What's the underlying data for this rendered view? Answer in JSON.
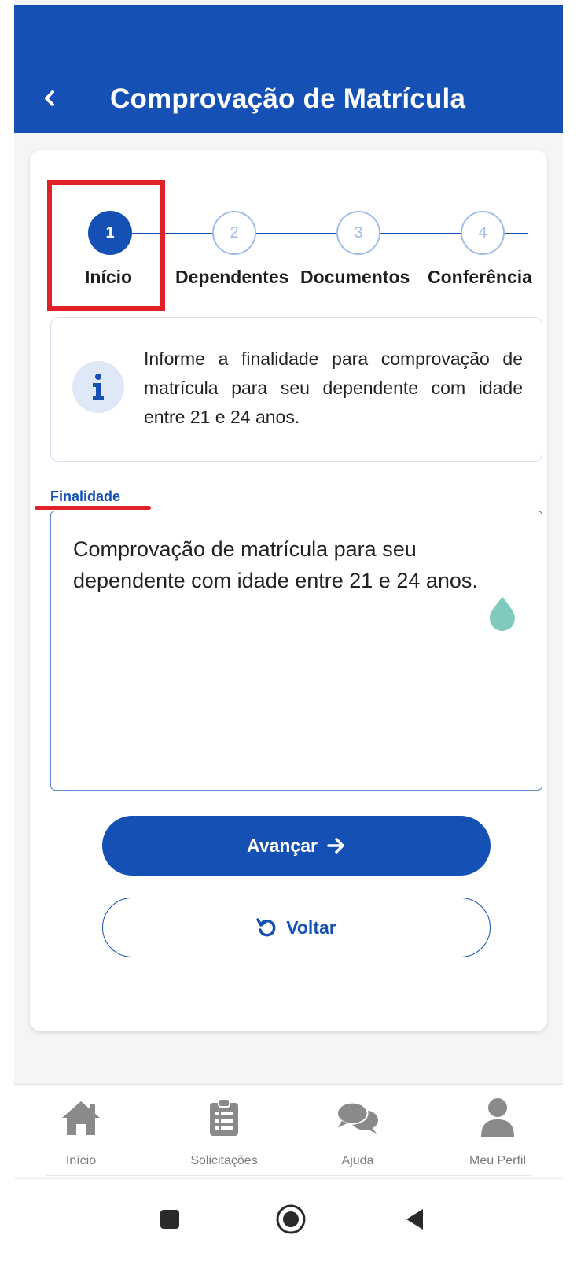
{
  "header": {
    "title": "Comprovação de Matrícula",
    "back_icon": "chevron-left-icon",
    "background_color": "#1550b4"
  },
  "stepper": {
    "steps": [
      {
        "number": "1",
        "label": "Início",
        "state": "active"
      },
      {
        "number": "2",
        "label": "Dependentes",
        "state": "inactive"
      },
      {
        "number": "3",
        "label": "Documentos",
        "state": "inactive"
      },
      {
        "number": "4",
        "label": "Conferência",
        "state": "inactive"
      }
    ],
    "active_color": "#1550b4",
    "inactive_color": "#9fbde8",
    "highlight_color": "#e02128"
  },
  "info": {
    "icon": "info-icon",
    "text": "Informe a finalidade para comprovação de matrícula para seu dependente com idade entre 21 e 24 anos."
  },
  "field": {
    "label": "Finalidade",
    "value": "Comprovação de matrícula para seu dependente com idade entre 21 e 24 anos."
  },
  "actions": {
    "primary_label": "Avançar",
    "primary_icon": "arrow-right-icon",
    "secondary_label": "Voltar",
    "secondary_icon": "undo-icon"
  },
  "bottom_nav": {
    "items": [
      {
        "label": "Início",
        "icon": "home-icon"
      },
      {
        "label": "Solicitações",
        "icon": "clipboard-icon"
      },
      {
        "label": "Ajuda",
        "icon": "chat-icon"
      },
      {
        "label": "Meu Perfil",
        "icon": "user-icon"
      }
    ]
  },
  "system_nav": {
    "items": [
      "recent-apps-icon",
      "home-circle-icon",
      "back-triangle-icon"
    ]
  }
}
